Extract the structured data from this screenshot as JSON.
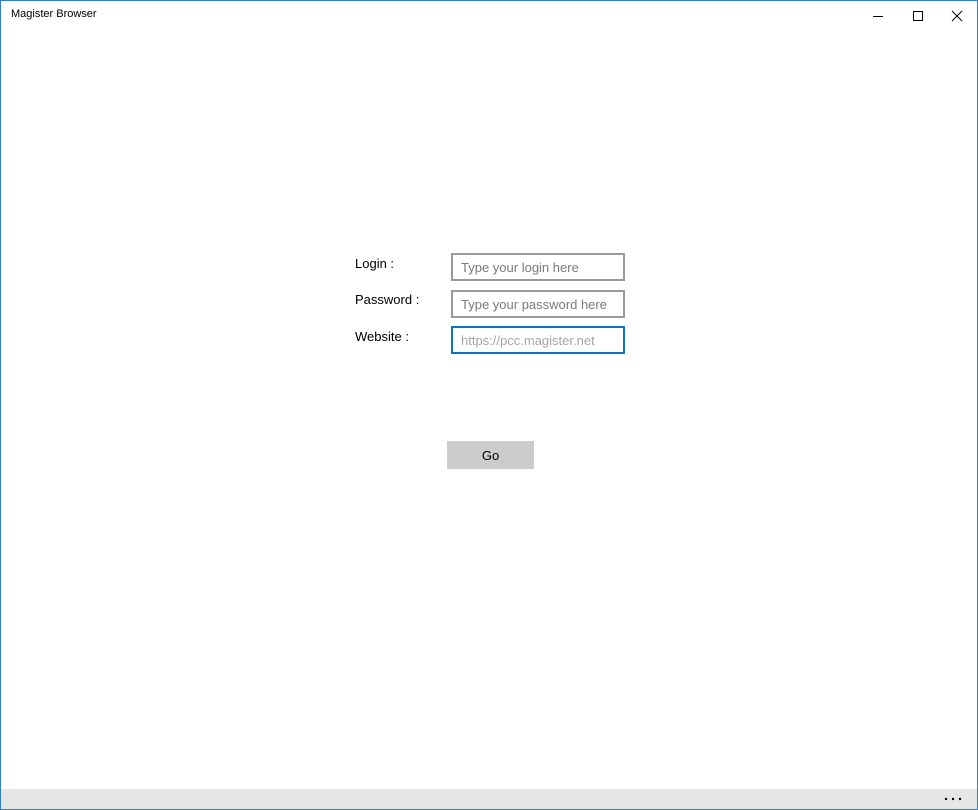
{
  "window": {
    "title": "Magister Browser"
  },
  "form": {
    "login_label": "Login :",
    "login_placeholder": "Type your login here",
    "login_value": "",
    "password_label": "Password :",
    "password_placeholder": "Type your password here",
    "password_value": "",
    "website_label": "Website :",
    "website_placeholder": "https://pcc.magister.net",
    "website_value": "",
    "go_label": "Go"
  },
  "icons": {
    "minimize": "minimize-icon",
    "maximize": "maximize-icon",
    "close": "close-icon",
    "more": "more-icon"
  },
  "colors": {
    "window_border": "#2d7fc9",
    "focus_border": "#0c73c5",
    "button_bg": "#cccccc",
    "appbar_bg": "#e6e6e6"
  }
}
